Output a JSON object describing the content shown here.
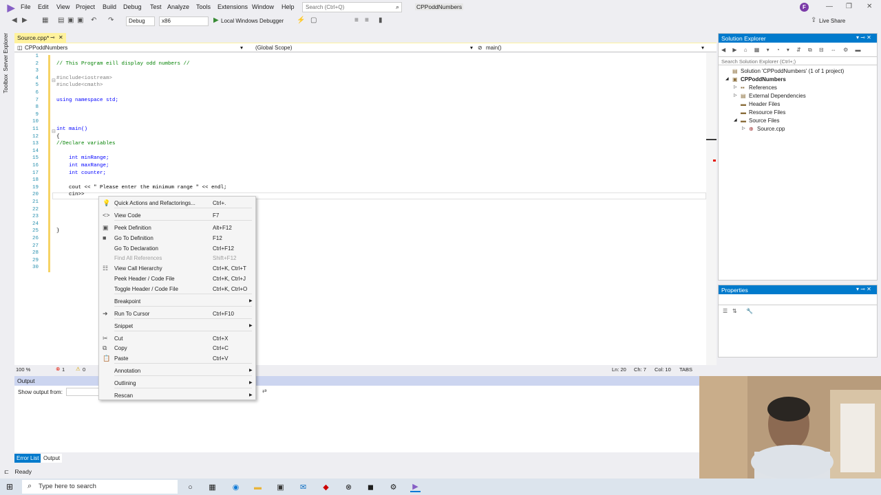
{
  "menubar": {
    "items": [
      "File",
      "Edit",
      "View",
      "Project",
      "Build",
      "Debug",
      "Test",
      "Analyze",
      "Tools",
      "Extensions",
      "Window",
      "Help"
    ],
    "search_placeholder": "Search (Ctrl+Q)",
    "solution_name": "CPPoddNumbers",
    "avatar_initial": "F"
  },
  "toolbar": {
    "config": "Debug",
    "platform": "x86",
    "run_label": "Local Windows Debugger",
    "live_share": "Live Share"
  },
  "side_labels": [
    "Server Explorer",
    "Toolbox"
  ],
  "editor": {
    "tab_name": "Source.cpp*",
    "nav_project": "CPPoddNumbers",
    "nav_scope": "(Global Scope)",
    "nav_member": "main()",
    "lines": [
      {
        "n": "1",
        "text": ""
      },
      {
        "n": "2",
        "text": "// This Program eill display odd numbers //"
      },
      {
        "n": "3",
        "text": ""
      },
      {
        "n": "4",
        "text": "#include<iostream>"
      },
      {
        "n": "5",
        "text": "#include<cmath>"
      },
      {
        "n": "6",
        "text": ""
      },
      {
        "n": "7",
        "text": "using namespace std;"
      },
      {
        "n": "8",
        "text": ""
      },
      {
        "n": "9",
        "text": ""
      },
      {
        "n": "10",
        "text": ""
      },
      {
        "n": "11",
        "text": "int main()"
      },
      {
        "n": "12",
        "text": "{"
      },
      {
        "n": "13",
        "text": "//Declare variables"
      },
      {
        "n": "14",
        "text": ""
      },
      {
        "n": "15",
        "text": "    int minRange;"
      },
      {
        "n": "16",
        "text": "    int maxRange;"
      },
      {
        "n": "17",
        "text": "    int counter;"
      },
      {
        "n": "18",
        "text": ""
      },
      {
        "n": "19",
        "text": "    cout << \" Please enter the minimum range \" << endl;"
      },
      {
        "n": "20",
        "text": "    cin>>"
      },
      {
        "n": "21",
        "text": ""
      },
      {
        "n": "22",
        "text": ""
      },
      {
        "n": "23",
        "text": ""
      },
      {
        "n": "24",
        "text": ""
      },
      {
        "n": "25",
        "text": "}"
      },
      {
        "n": "26",
        "text": ""
      },
      {
        "n": "27",
        "text": ""
      },
      {
        "n": "28",
        "text": ""
      },
      {
        "n": "29",
        "text": ""
      },
      {
        "n": "30",
        "text": ""
      }
    ],
    "zoom": "100 %",
    "errors": "1",
    "warnings": "0",
    "ln": "Ln: 20",
    "ch": "Ch: 7",
    "col": "Col: 10",
    "tabs": "TABS"
  },
  "context_menu": {
    "items": [
      {
        "label": "Quick Actions and Refactorings...",
        "shortcut": "Ctrl+.",
        "icon": "lightbulb-icon",
        "glyph": "💡",
        "submenu": false,
        "disabled": false
      },
      {
        "label": "View Code",
        "shortcut": "F7",
        "icon": "code-icon",
        "glyph": "<>",
        "submenu": false,
        "disabled": false
      },
      {
        "label": "Peek Definition",
        "shortcut": "Alt+F12",
        "icon": "peek-icon",
        "glyph": "▣",
        "submenu": false,
        "disabled": false
      },
      {
        "label": "Go To Definition",
        "shortcut": "F12",
        "icon": "goto-definition-icon",
        "glyph": "■",
        "submenu": false,
        "disabled": false
      },
      {
        "label": "Go To Declaration",
        "shortcut": "Ctrl+F12",
        "icon": "",
        "glyph": "",
        "submenu": false,
        "disabled": false
      },
      {
        "label": "Find All References",
        "shortcut": "Shift+F12",
        "icon": "",
        "glyph": "",
        "submenu": false,
        "disabled": true
      },
      {
        "label": "View Call Hierarchy",
        "shortcut": "Ctrl+K, Ctrl+T",
        "icon": "call-hierarchy-icon",
        "glyph": "☷",
        "submenu": false,
        "disabled": false
      },
      {
        "label": "Peek Header / Code File",
        "shortcut": "Ctrl+K, Ctrl+J",
        "icon": "",
        "glyph": "",
        "submenu": false,
        "disabled": false
      },
      {
        "label": "Toggle Header / Code File",
        "shortcut": "Ctrl+K, Ctrl+O",
        "icon": "",
        "glyph": "",
        "submenu": false,
        "disabled": false
      },
      {
        "label": "Breakpoint",
        "shortcut": "",
        "icon": "",
        "glyph": "",
        "submenu": true,
        "disabled": false
      },
      {
        "label": "Run To Cursor",
        "shortcut": "Ctrl+F10",
        "icon": "run-cursor-icon",
        "glyph": "➜",
        "submenu": false,
        "disabled": false
      },
      {
        "label": "Snippet",
        "shortcut": "",
        "icon": "",
        "glyph": "",
        "submenu": true,
        "disabled": false
      },
      {
        "label": "Cut",
        "shortcut": "Ctrl+X",
        "icon": "cut-icon",
        "glyph": "✂",
        "submenu": false,
        "disabled": false
      },
      {
        "label": "Copy",
        "shortcut": "Ctrl+C",
        "icon": "copy-icon",
        "glyph": "⧉",
        "submenu": false,
        "disabled": false
      },
      {
        "label": "Paste",
        "shortcut": "Ctrl+V",
        "icon": "paste-icon",
        "glyph": "📋",
        "submenu": false,
        "disabled": false
      },
      {
        "label": "Annotation",
        "shortcut": "",
        "icon": "",
        "glyph": "",
        "submenu": true,
        "disabled": false
      },
      {
        "label": "Outlining",
        "shortcut": "",
        "icon": "",
        "glyph": "",
        "submenu": true,
        "disabled": false
      },
      {
        "label": "Rescan",
        "shortcut": "",
        "icon": "",
        "glyph": "",
        "submenu": true,
        "disabled": false
      }
    ]
  },
  "solution_explorer": {
    "title": "Solution Explorer",
    "search_placeholder": "Search Solution Explorer (Ctrl+;)",
    "items": [
      {
        "label": "Solution 'CPPoddNumbers' (1 of 1 project)",
        "glyph": "▤"
      },
      {
        "label": "CPPoddNumbers",
        "glyph": "▣"
      },
      {
        "label": "References",
        "glyph": "▪▪"
      },
      {
        "label": "External Dependencies",
        "glyph": "▤"
      },
      {
        "label": "Header Files",
        "glyph": "▬"
      },
      {
        "label": "Resource Files",
        "glyph": "▬"
      },
      {
        "label": "Source Files",
        "glyph": "▬"
      },
      {
        "label": "Source.cpp",
        "glyph": "⊕"
      }
    ]
  },
  "properties": {
    "title": "Properties"
  },
  "output": {
    "title": "Output",
    "show_from": "Show output from:"
  },
  "bottom_tabs": [
    "Error List",
    "Output"
  ],
  "status": "Ready",
  "taskbar": {
    "search_placeholder": "Type here to search"
  }
}
